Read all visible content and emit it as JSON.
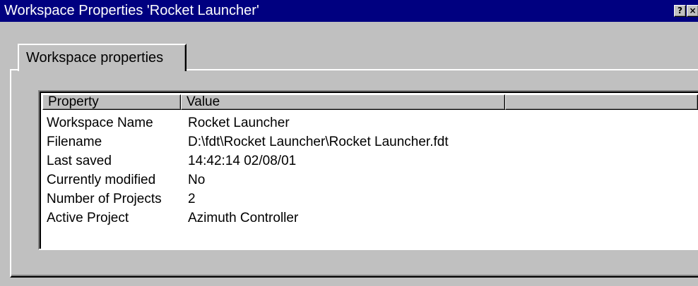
{
  "window": {
    "title": "Workspace Properties 'Rocket Launcher'",
    "help_glyph": "?",
    "close_glyph": "×"
  },
  "tabs": [
    {
      "label": "Workspace properties",
      "selected": true
    }
  ],
  "table": {
    "columns": [
      "Property",
      "Value",
      ""
    ],
    "rows": [
      {
        "property": "Workspace Name",
        "value": "Rocket Launcher"
      },
      {
        "property": "Filename",
        "value": "D:\\fdt\\Rocket Launcher\\Rocket Launcher.fdt"
      },
      {
        "property": "Last saved",
        "value": "14:42:14   02/08/01"
      },
      {
        "property": "Currently modified",
        "value": "No"
      },
      {
        "property": "Number of Projects",
        "value": "2"
      },
      {
        "property": "Active Project",
        "value": "Azimuth Controller"
      }
    ]
  }
}
